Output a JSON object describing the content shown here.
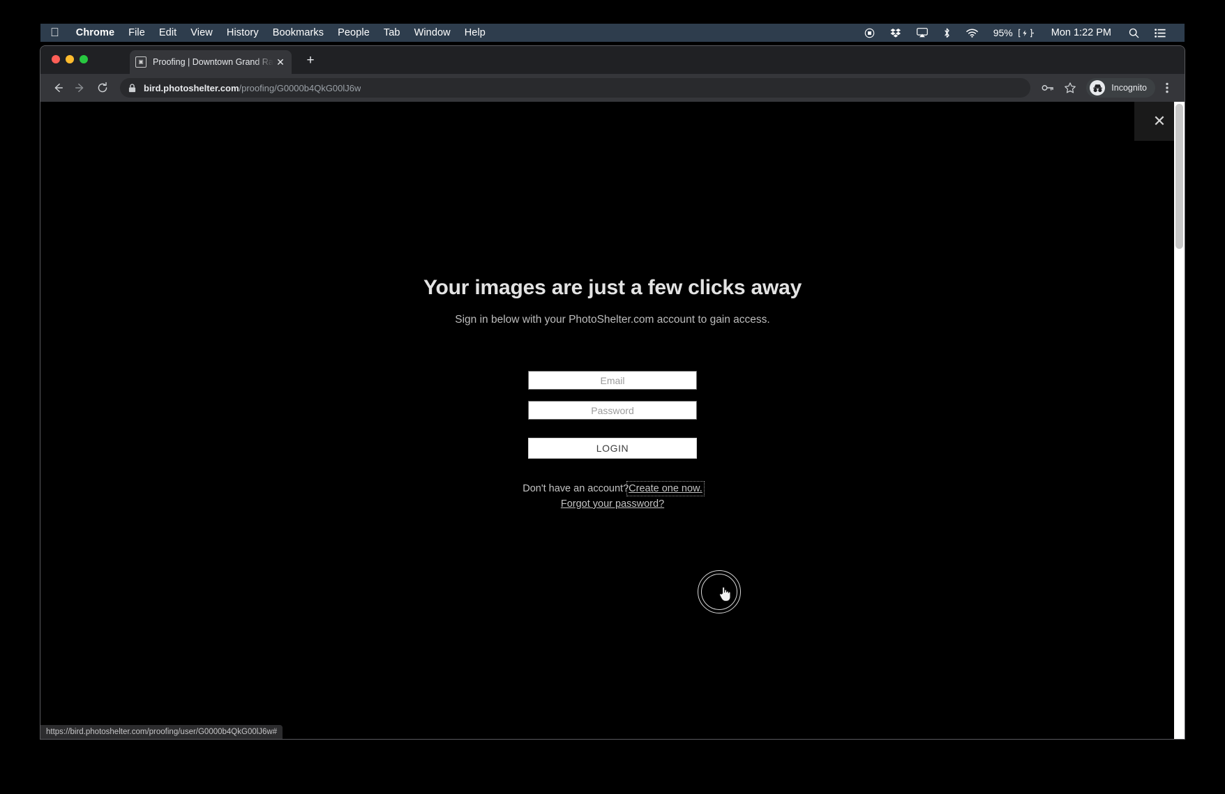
{
  "menubar": {
    "apple_icon": "apple-logo",
    "items": [
      {
        "label": "Chrome",
        "bold": true
      },
      {
        "label": "File",
        "bold": false
      },
      {
        "label": "Edit",
        "bold": false
      },
      {
        "label": "View",
        "bold": false
      },
      {
        "label": "History",
        "bold": false
      },
      {
        "label": "Bookmarks",
        "bold": false
      },
      {
        "label": "People",
        "bold": false
      },
      {
        "label": "Tab",
        "bold": false
      },
      {
        "label": "Window",
        "bold": false
      },
      {
        "label": "Help",
        "bold": false
      }
    ],
    "status_icons": [
      {
        "name": "screen-record-icon"
      },
      {
        "name": "dropbox-icon"
      },
      {
        "name": "airplay-icon"
      },
      {
        "name": "bluetooth-icon"
      },
      {
        "name": "wifi-icon"
      }
    ],
    "battery_percent": "95%",
    "battery_icon": "battery-charging-icon",
    "clock": "Mon 1:22 PM",
    "spotlight_icon": "search-icon",
    "notification_icon": "control-center-icon",
    "bar_color": "#2e3d4d"
  },
  "browser": {
    "traffic_lights": [
      "close",
      "minimize",
      "zoom"
    ],
    "tab": {
      "title": "Proofing | Downtown Grand Ra",
      "favicon": "camera-icon",
      "close_label": "✕"
    },
    "new_tab_label": "+",
    "toolbar": {
      "back_label": "←",
      "forward_label": "→",
      "reload_label": "⟳",
      "lock_icon": "lock-icon",
      "url_domain": "bird.photoshelter.com",
      "url_path": "/proofing/G0000b4QkG00lJ6w",
      "key_icon": "key-icon",
      "bookmark_icon": "star-icon",
      "profile_label": "Incognito",
      "profile_icon": "incognito-icon",
      "menu_icon": "three-dot-menu-icon"
    },
    "status_url": "https://bird.photoshelter.com/proofing/user/G0000b4QkG00lJ6w#"
  },
  "page": {
    "close_label": "✕",
    "heading": "Your images are just a few clicks away",
    "subheading": "Sign in below with your PhotoShelter.com account to gain access.",
    "email_placeholder": "Email",
    "email_value": "",
    "password_placeholder": "Password",
    "password_value": "",
    "login_label": "LOGIN",
    "no_account_text": "Don't have an account?",
    "create_link": "Create one now.",
    "forgot_link": "Forgot your password?",
    "background": "#000000",
    "field_background": "#ffffff",
    "text_color": "#c3c3c3"
  }
}
